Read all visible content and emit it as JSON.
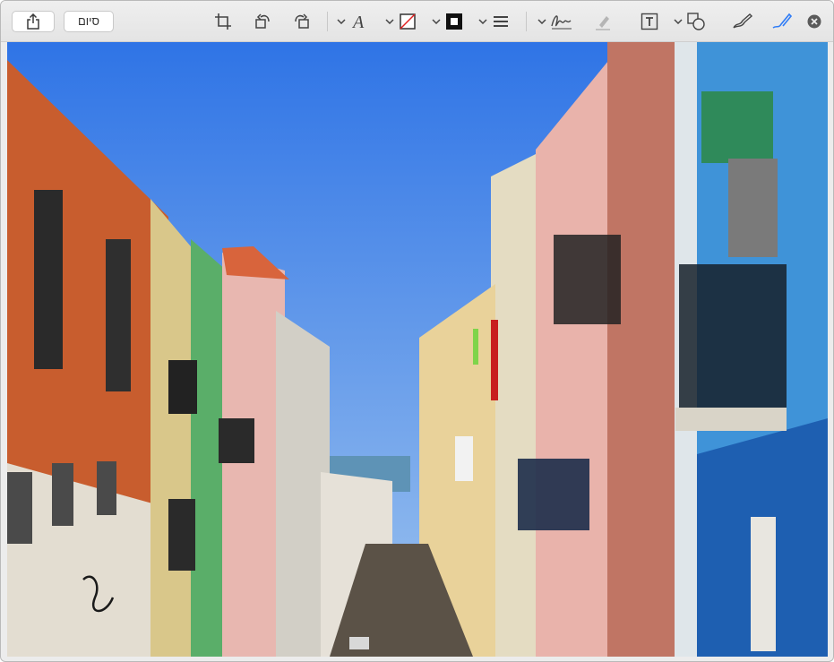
{
  "toolbar": {
    "done_label": "סיום",
    "share_icon": "share-icon",
    "tools": [
      "crop-icon",
      "rotate-left-icon",
      "rotate-right-icon",
      "text-style-icon",
      "border-color-icon",
      "fill-color-icon",
      "line-style-icon",
      "signature-icon",
      "highlight-icon",
      "text-box-icon",
      "shapes-icon",
      "markup-sketch-icon",
      "markup-draw-icon",
      "close-icon"
    ],
    "accent_color": "#2f7cf6"
  },
  "image": {
    "description_icon": "street-photo",
    "sky_color": "#4b8ff0"
  }
}
